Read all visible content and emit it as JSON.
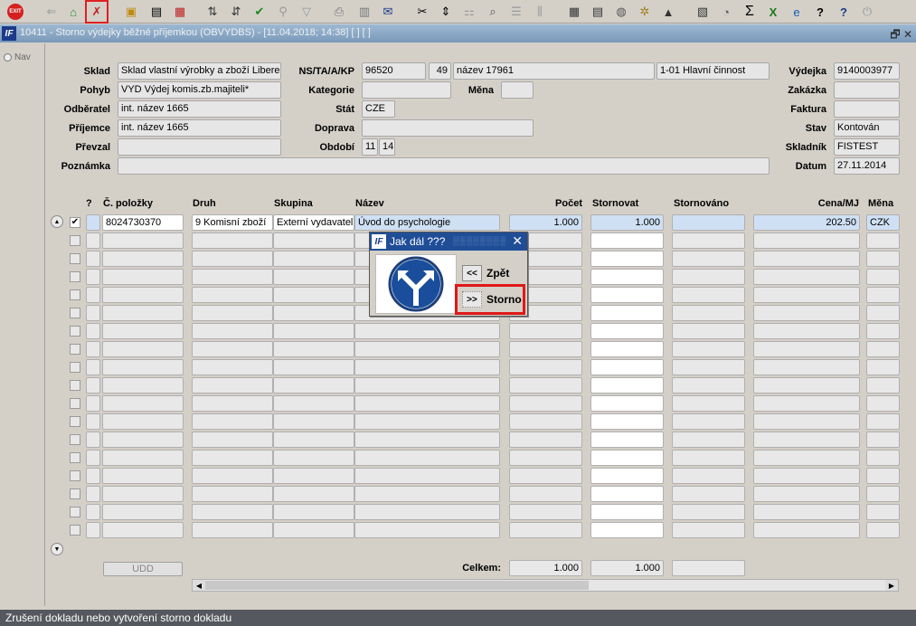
{
  "window": {
    "title": "10411 - Storno výdejky běžné příjemkou (OBVYDBS) - [11.04.2018; 14:38] [ ] [ ]",
    "logo": "IF"
  },
  "nav": {
    "label": "Nav"
  },
  "header": {
    "sklad_label": "Sklad",
    "sklad_value": "Sklad vlastní výrobky a zboží Liberec",
    "pohyb_label": "Pohyb",
    "pohyb_value": "VYD Výdej komis.zb.majiteli*",
    "odberatel_label": "Odběratel",
    "odberatel_value": "int. název 1665",
    "prijemce_label": "Příjemce",
    "prijemce_value": "int. název 1665",
    "prevzal_label": "Převzal",
    "prevzal_value": "",
    "poznamka_label": "Poznámka",
    "poznamka_value": "",
    "ns_label": "NS/TA/A/KP",
    "ns_value": "96520",
    "ta_value": "49",
    "a_value": "název 17961",
    "kp_value": "1-01 Hlavní činnost",
    "kategorie_label": "Kategorie",
    "kategorie_value": "",
    "mena_label": "Měna",
    "mena_value": "",
    "stat_label": "Stát",
    "stat_value": "CZE",
    "doprava_label": "Doprava",
    "doprava_value": "",
    "obdobi_label": "Období",
    "obdobi_month": "11",
    "obdobi_year": "14",
    "vydejka_label": "Výdejka",
    "vydejka_value": "9140003977",
    "zakazka_label": "Zakázka",
    "zakazka_value": "",
    "faktura_label": "Faktura",
    "faktura_value": "",
    "stav_label": "Stav",
    "stav_value": "Kontován",
    "skladnik_label": "Skladník",
    "skladnik_value": "FISTEST",
    "datum_label": "Datum",
    "datum_value": "27.11.2014"
  },
  "table": {
    "columns": {
      "q": "?",
      "polozka": "Č. položky",
      "druh": "Druh",
      "skupina": "Skupina",
      "nazev": "Název",
      "pocet": "Počet",
      "stornovat": "Stornovat",
      "stornovano": "Stornováno",
      "cena": "Cena/MJ",
      "mena": "Měna"
    },
    "rows": [
      {
        "checked": true,
        "polozka": "8024730370",
        "druh": "9 Komisní zboží",
        "skupina": "Externí vydavatel",
        "nazev": "Úvod do psychologie",
        "pocet": "1.000",
        "stornovat": "1.000",
        "stornovano": "",
        "cena": "202.50",
        "mena": "CZK"
      }
    ],
    "total_label": "Celkem:",
    "total_pocet": "1.000",
    "total_stornovat": "1.000",
    "udd_label": "UDD"
  },
  "dialog": {
    "title": "Jak dál ???",
    "back_button": "<<",
    "back_label": "Zpět",
    "storno_button": ">>",
    "storno_label": "Storno"
  },
  "status_bar": "Zrušení dokladu nebo vytvoření storno dokladu",
  "colors": {
    "highlight": "#e01818",
    "title_bar": "#8aa6c4",
    "dialog_title": "#1f4e97",
    "selected_row": "#cfe0f4"
  }
}
